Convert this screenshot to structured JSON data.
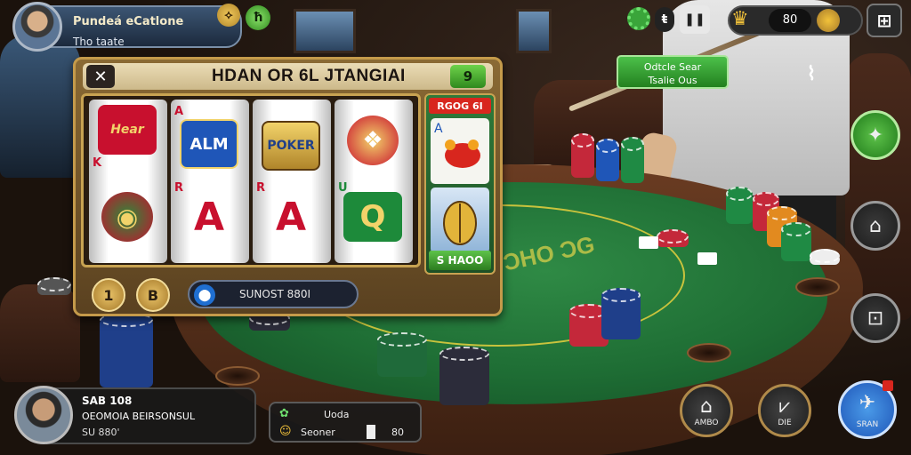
{
  "profile": {
    "name": "Pundeá eCatlone",
    "subtitle": "Tho taate",
    "btn_a": "⟡",
    "btn_b": "ħ"
  },
  "slot": {
    "title": "HDAN OR 6L JTANGIAI",
    "close": "✕",
    "badge": "9",
    "reels": [
      {
        "top": "Hear",
        "mid": "K",
        "mid_color": "#c8102e",
        "bottom": "◉"
      },
      {
        "top": "ALM",
        "mid": "A",
        "mid_color": "#c8102e",
        "bottom": ""
      },
      {
        "top": "POKER",
        "mid": "A",
        "mid_color": "#c8102e",
        "bottom": ""
      },
      {
        "top": "❖",
        "mid": "Q",
        "mid_color": "#1d8a3a",
        "bottom": ""
      }
    ],
    "corner_top": [
      "A",
      "A",
      "",
      ""
    ],
    "corner_mid": [
      "K",
      "R",
      "R",
      "U"
    ],
    "side_head": "RGOG 6I",
    "side_foot": "S HAOO",
    "coin_a": "1",
    "coin_b": "B",
    "bet_text": "SUNOST 880I"
  },
  "toolbar": {
    "gear_label": "",
    "bet_symbol": "ŧ",
    "pause": "❚❚",
    "coins": "80",
    "grid": "⊞"
  },
  "promo": {
    "line1": "Odtcle Sear",
    "line2": "Tsalie Ous"
  },
  "side_buttons": [
    {
      "name": "shield",
      "glyph": "✦"
    },
    {
      "name": "home",
      "glyph": "⌂"
    },
    {
      "name": "lock",
      "glyph": "⊡"
    }
  ],
  "player": {
    "badge": "SAB 108",
    "name": "OEOMOIA BEIRSONSUL",
    "sub": "SU 880'"
  },
  "chat": {
    "line1": "Uoda",
    "line2": "Seoner",
    "value": "80"
  },
  "actions": [
    {
      "name": "home",
      "glyph": "⌂",
      "label": "AMBO"
    },
    {
      "name": "check",
      "glyph": "⩗",
      "label": "DIE"
    },
    {
      "name": "bird",
      "glyph": "✈",
      "label": "SRAN"
    }
  ]
}
